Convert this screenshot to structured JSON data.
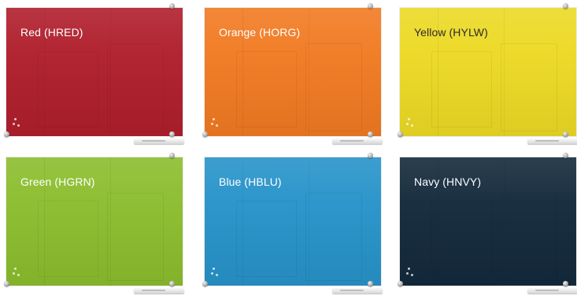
{
  "boards": [
    {
      "label": "Red (HRED)",
      "color": "#b01e2c",
      "text_color": "#ffffff"
    },
    {
      "label": "Orange (HORG)",
      "color": "#f17a22",
      "text_color": "#ffffff"
    },
    {
      "label": "Yellow (HYLW)",
      "color": "#ecd924",
      "text_color": "#2b2b2b"
    },
    {
      "label": "Green (HGRN)",
      "color": "#8bbd2d",
      "text_color": "#ffffff"
    },
    {
      "label": "Blue (HBLU)",
      "color": "#2793c9",
      "text_color": "#ffffff"
    },
    {
      "label": "Navy (HNVY)",
      "color": "#13293b",
      "text_color": "#ffffff"
    }
  ]
}
